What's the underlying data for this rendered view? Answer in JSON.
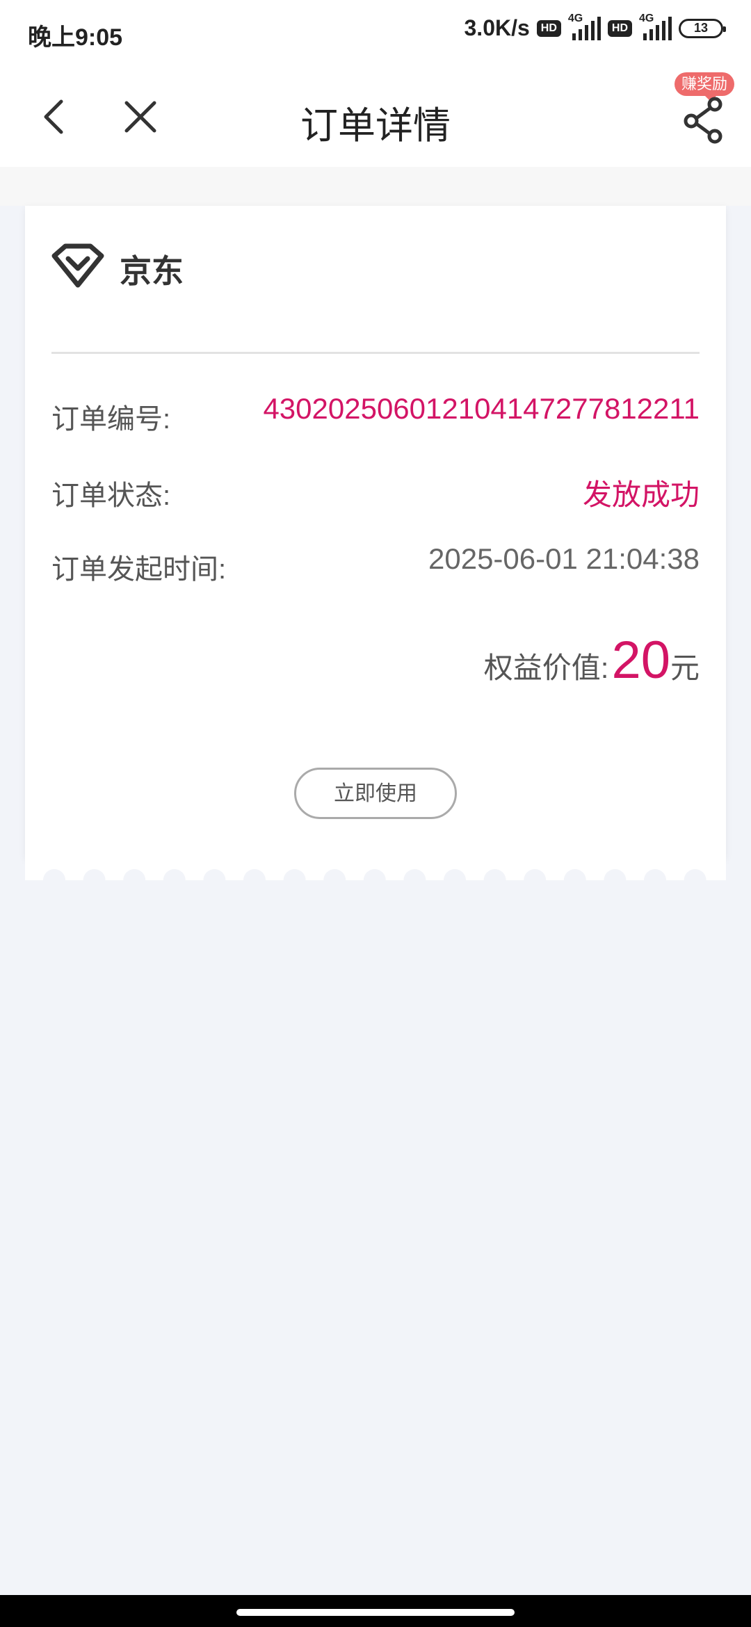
{
  "status_bar": {
    "time": "晚上9:05",
    "speed": "3.0K/s",
    "hd_badge_1": "HD",
    "hd_badge_2": "HD",
    "network_1": "4G",
    "network_2": "4G",
    "battery": "13"
  },
  "nav": {
    "title": "订单详情",
    "back_icon": "chevron-left-icon",
    "close_icon": "close-icon",
    "share_icon": "share-icon",
    "reward_badge": "赚奖励"
  },
  "order": {
    "brand_logo_icon": "jd-diamond-logo-icon",
    "brand_name": "京东",
    "order_no_label": "订单编号:",
    "order_no_value": "430202506012104147277812211",
    "status_label": "订单状态:",
    "status_value": "发放成功",
    "time_label": "订单发起时间:",
    "time_value": "2025-06-01 21:04:38",
    "price_label": "权益价值:",
    "price_value": "20",
    "price_unit": "元",
    "use_button": "立即使用"
  },
  "colors": {
    "accent": "#d31465",
    "reward_badge": "#ee6b6b",
    "background": "#f2f4f9"
  }
}
